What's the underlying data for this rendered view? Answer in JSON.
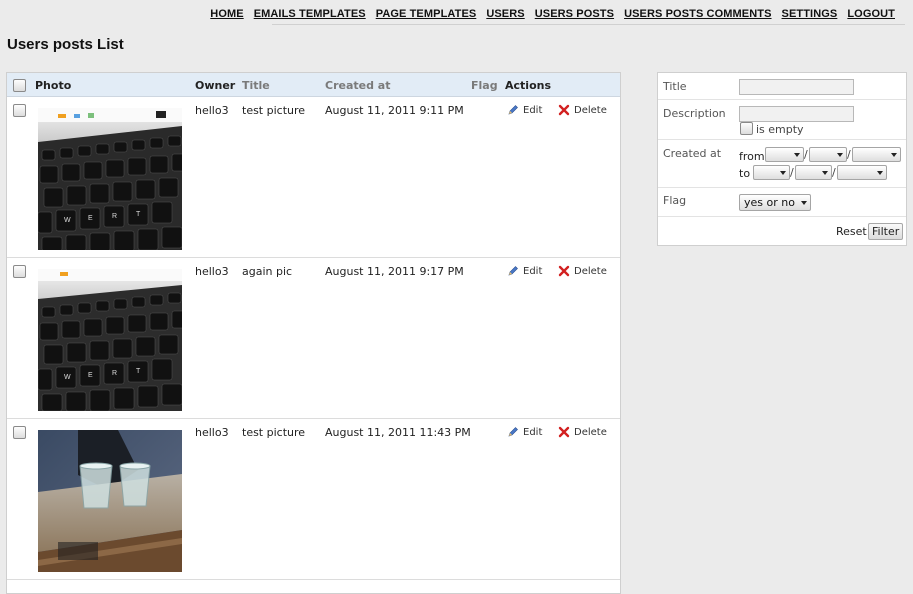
{
  "nav": {
    "items": [
      "HOME",
      "EMAILS TEMPLATES",
      "PAGE TEMPLATES",
      "USERS",
      "USERS POSTS",
      "USERS POSTS COMMENTS",
      "SETTINGS",
      "LOGOUT"
    ]
  },
  "page": {
    "title": "Users posts List"
  },
  "table": {
    "headers": {
      "photo": "Photo",
      "owner": "Owner",
      "title": "Title",
      "created_at": "Created at",
      "flag": "Flag",
      "actions": "Actions"
    },
    "edit_label": "Edit",
    "delete_label": "Delete",
    "rows": [
      {
        "owner": "hello3",
        "title": "test picture",
        "created_at": "August 11, 2011 9:11 PM",
        "photo": "laptop-keyboard-photo"
      },
      {
        "owner": "hello3",
        "title": "again pic",
        "created_at": "August 11, 2011 9:17 PM",
        "photo": "laptop-keyboard-photo"
      },
      {
        "owner": "hello3",
        "title": "test picture",
        "created_at": "August 11, 2011 11:43 PM",
        "photo": "glasses-on-desk-photo"
      }
    ]
  },
  "filters": {
    "title_label": "Title",
    "title_value": "",
    "description_label": "Description",
    "description_value": "",
    "is_empty_label": "is empty",
    "created_at_label": "Created at",
    "from_label": "from",
    "to_label": "to",
    "date_separator": "/",
    "flag_label": "Flag",
    "flag_value": "yes or no",
    "reset_label": "Reset",
    "filter_label": "Filter"
  },
  "colors": {
    "header_bg": "#e2ecf6",
    "page_bg": "#ebebeb",
    "edit_icon": "#3a6fc4",
    "delete_icon": "#d22020"
  }
}
